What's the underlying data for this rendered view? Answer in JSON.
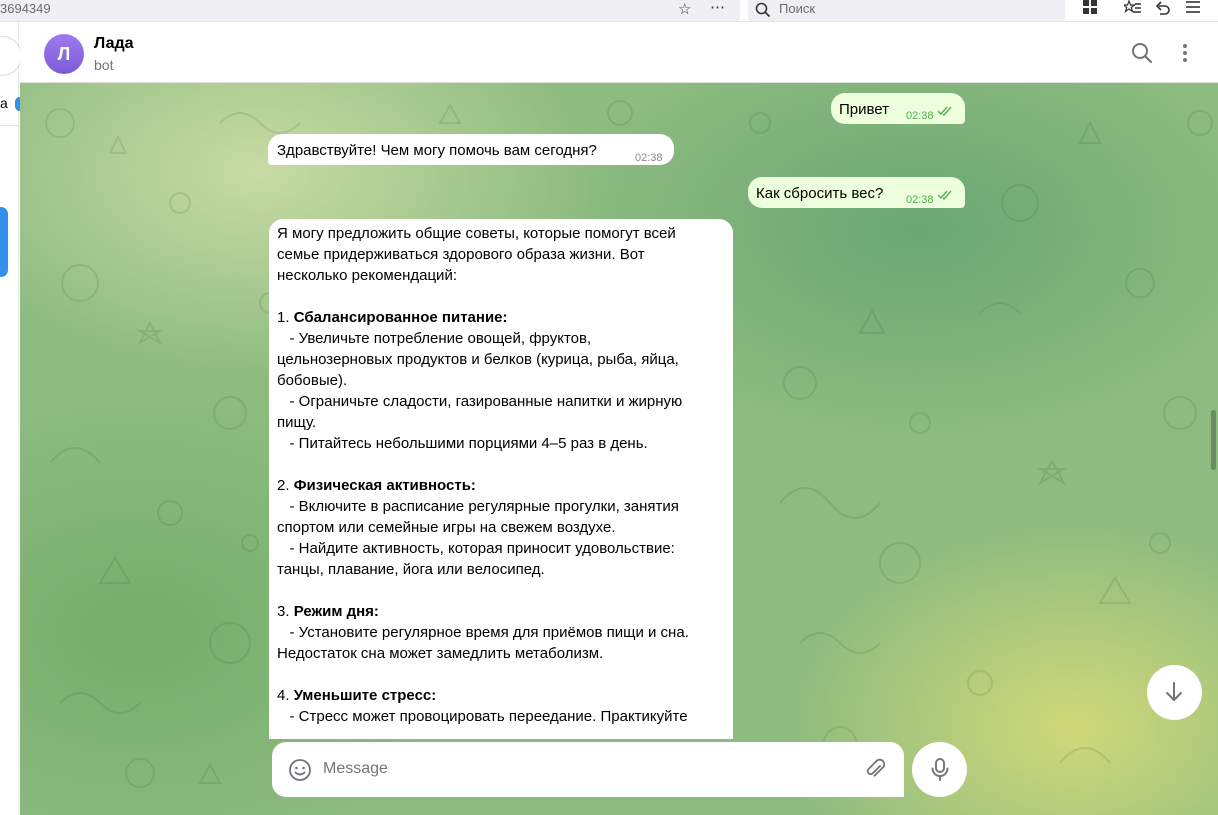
{
  "browser": {
    "url_fragment": "3694349",
    "search_placeholder": "Поиск"
  },
  "sidebar": {
    "cut_text": "а"
  },
  "header": {
    "avatar_letter": "Л",
    "name": "Лада",
    "status": "bot"
  },
  "messages": [
    {
      "direction": "out",
      "text": "Привет",
      "time": "02:38",
      "read": true
    },
    {
      "direction": "in",
      "text": "Здравствуйте! Чем могу помочь вам сегодня?",
      "time": "02:38"
    },
    {
      "direction": "out",
      "text": "Как сбросить вес?",
      "time": "02:38",
      "read": true
    }
  ],
  "long_message": {
    "intro": [
      "Я могу предложить общие советы, которые помогут всей",
      "семье придерживаться здорового образа жизни. Вот",
      "несколько рекомендаций:"
    ],
    "s1_num": "1. ",
    "s1_title": "Сбалансированное питание:",
    "s1_lines": [
      "   - Увеличьте потребление овощей, фруктов,",
      "цельнозерновых продуктов и белков (курица, рыба, яйца,",
      "бобовые).",
      "   - Ограничьте сладости, газированные напитки и жирную",
      "пищу.",
      "   - Питайтесь небольшими порциями 4–5 раз в день."
    ],
    "s2_num": "2. ",
    "s2_title": "Физическая активность:",
    "s2_lines": [
      "   - Включите в расписание регулярные прогулки, занятия",
      "спортом или семейные игры на свежем воздухе.",
      "   - Найдите активность, которая приносит удовольствие:",
      "танцы, плавание, йога или велосипед."
    ],
    "s3_num": "3. ",
    "s3_title": "Режим дня:",
    "s3_lines": [
      "   - Установите регулярное время для приёмов пищи и сна.",
      "Недостаток сна может замедлить метаболизм."
    ],
    "s4_num": "4. ",
    "s4_title": "Уменьшите стресс:",
    "s4_lines": [
      "   - Стресс может провоцировать переедание. Практикуйте"
    ]
  },
  "composer": {
    "placeholder": "Message"
  },
  "icons": {
    "bookmark": "star-icon",
    "page_menu": "more-horizontal-icon",
    "search": "search-icon",
    "header_search": "search-icon",
    "header_menu": "more-vertical-icon",
    "emoji": "smile-icon",
    "attach": "paperclip-icon",
    "mic": "microphone-icon",
    "scroll_down": "arrow-down-icon"
  },
  "colors": {
    "outgoing_bubble": "#eeffde",
    "incoming_bubble": "#ffffff",
    "avatar": "#8e6be6",
    "read_check": "#4fae4e"
  }
}
